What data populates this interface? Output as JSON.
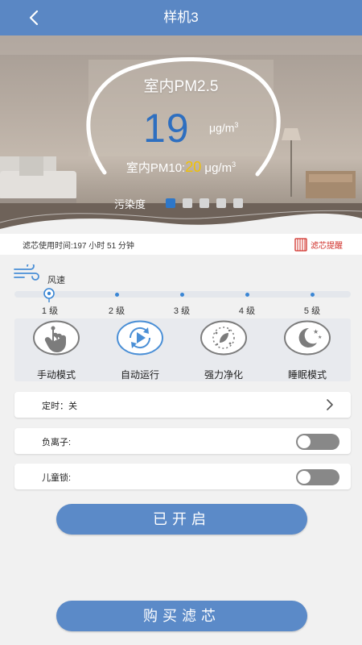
{
  "header": {
    "title": "样机3",
    "back_icon": "chevron-left-icon"
  },
  "air_quality": {
    "pm25_title": "室内PM2.5",
    "pm25_value": "19",
    "pm25_unit": "μg/m",
    "pm25_unit_exp": "3",
    "pm10_prefix": "室内PM10:",
    "pm10_value": "20",
    "pm10_unit": " μg/m",
    "pm10_unit_exp": "3",
    "pollution_label": "污染度",
    "pollution_level": 1,
    "pollution_levels_total": 5,
    "colors": {
      "pm25": "#2e6fc0",
      "pm10": "#f2c200",
      "active_dot": "#2e77c8"
    }
  },
  "filter": {
    "usage_text": "滤芯使用时间:197 小时 51 分钟",
    "remind_label": "滤芯提醒",
    "remind_icon": "filter-cartridge-icon"
  },
  "wind": {
    "icon": "wind-icon",
    "label": "风速",
    "levels": [
      "1 级",
      "2 级",
      "3 级",
      "4 级",
      "5 级"
    ],
    "selected": "1 级"
  },
  "modes": [
    {
      "label": "手动模式",
      "icon": "hand-tap-icon",
      "active": false
    },
    {
      "label": "自动运行",
      "icon": "auto-play-icon",
      "active": true
    },
    {
      "label": "强力净化",
      "icon": "leaf-particles-icon",
      "active": false
    },
    {
      "label": "睡眠模式",
      "icon": "moon-stars-icon",
      "active": false
    }
  ],
  "settings": {
    "timer_label": "定时：关",
    "anion_label": "负离子:",
    "anion_on": false,
    "child_lock_label": "儿童锁:",
    "child_lock_on": false
  },
  "buttons": {
    "power": "已开启",
    "buy_filter": "购买滤芯"
  },
  "theme": {
    "primary": "#5a87c4",
    "accent_blue": "#3a86d4",
    "alert_red": "#d0302a"
  }
}
